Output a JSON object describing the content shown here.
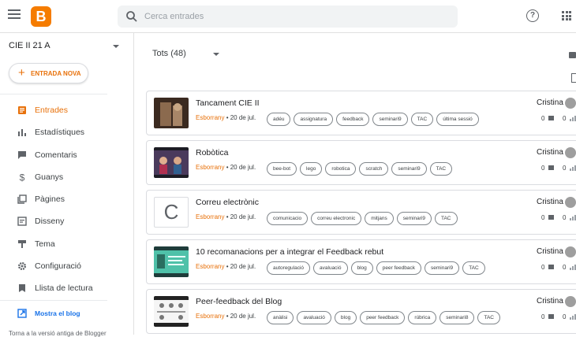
{
  "header": {
    "search_placeholder": "Cerca entrades",
    "logo_letter": "B",
    "help_glyph": "?"
  },
  "sidebar": {
    "blog_name": "CIE II 21 A",
    "new_post_label": "ENTRADA NOVA",
    "items": [
      {
        "label": "Entrades",
        "icon": "posts-icon",
        "active": true
      },
      {
        "label": "Estadístiques",
        "icon": "stats-icon",
        "active": false
      },
      {
        "label": "Comentaris",
        "icon": "comments-icon",
        "active": false
      },
      {
        "label": "Guanys",
        "icon": "dollar-icon",
        "active": false
      },
      {
        "label": "Pàgines",
        "icon": "pages-icon",
        "active": false
      },
      {
        "label": "Disseny",
        "icon": "layout-icon",
        "active": false
      },
      {
        "label": "Tema",
        "icon": "theme-icon",
        "active": false
      },
      {
        "label": "Configuració",
        "icon": "gear-icon",
        "active": false
      },
      {
        "label": "Llista de lectura",
        "icon": "bookmark-icon",
        "active": false
      }
    ],
    "view_blog_label": "Mostra el blog",
    "old_version_label": "Torna a la versió antiga de Blogger"
  },
  "main": {
    "filter_label": "Tots (48)"
  },
  "posts": [
    {
      "title": "Tancament CIE II",
      "status": "Esborrany",
      "date": " • 20 de jul.",
      "labels": [
        "adéu",
        "assignatura",
        "feedback",
        "seminari9",
        "TAC",
        "última sessió"
      ],
      "author": "Cristina",
      "comments": "0",
      "views": "0"
    },
    {
      "title": "Robòtica",
      "status": "Esborrany",
      "date": " • 20 de jul.",
      "labels": [
        "bee-bot",
        "lego",
        "robotica",
        "scratch",
        "seminari9",
        "TAC"
      ],
      "author": "Cristina",
      "comments": "0",
      "views": "0"
    },
    {
      "title": "Correu electrònic",
      "status": "Esborrany",
      "date": " • 20 de jul.",
      "labels": [
        "comunicacio",
        "correu electronic",
        "mitjans",
        "seminari9",
        "TAC"
      ],
      "author": "Cristina",
      "comments": "0",
      "views": "0",
      "thumb_letter": "C"
    },
    {
      "title": "10 recomanacions per a integrar el Feedback rebut",
      "status": "Esborrany",
      "date": " • 20 de jul.",
      "labels": [
        "autoregulació",
        "avaluació",
        "blog",
        "peer feedback",
        "seminari9",
        "TAC"
      ],
      "author": "Cristina",
      "comments": "0",
      "views": "0"
    },
    {
      "title": "Peer-feedback del Blog",
      "status": "Esborrany",
      "date": " • 20 de jul.",
      "labels": [
        "anàlisi",
        "avaluació",
        "blog",
        "peer feedback",
        "rúbrica",
        "seminari8",
        "TAC"
      ],
      "author": "Cristina",
      "comments": "0",
      "views": "0"
    }
  ],
  "colors": {
    "accent": "#e8710a",
    "logo": "#f57c00"
  }
}
